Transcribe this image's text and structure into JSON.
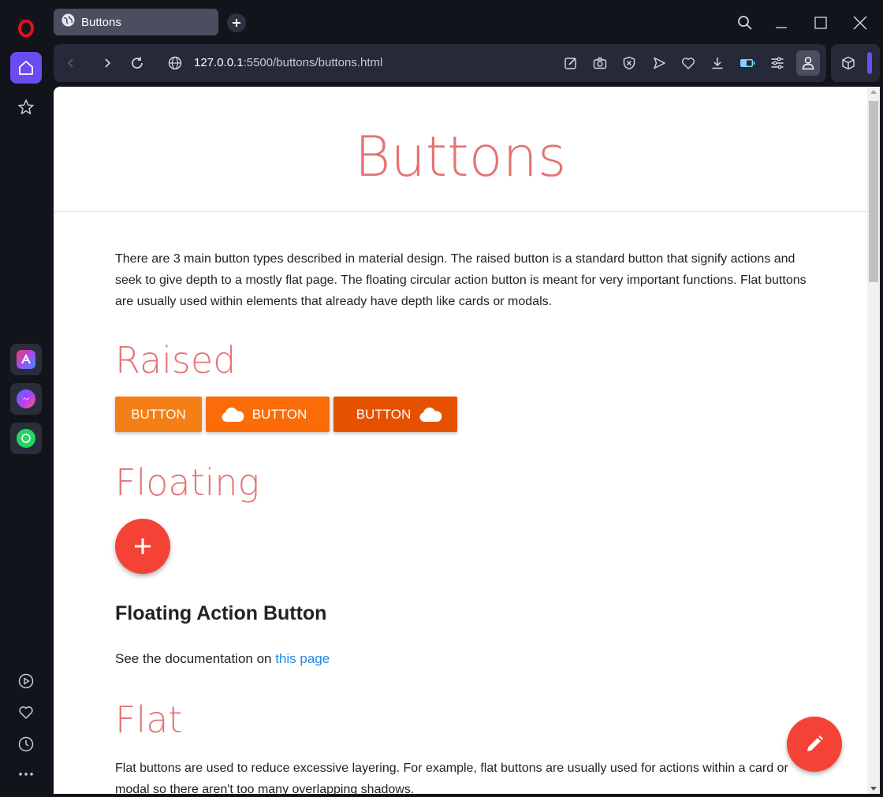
{
  "browser": {
    "tab": {
      "title": "Buttons"
    },
    "address": {
      "host": "127.0.0.1",
      "rest": ":5500/buttons/buttons.html"
    }
  },
  "page": {
    "title": "Buttons",
    "intro": "There are 3 main button types described in material design. The raised button is a standard button that signify actions and seek to give depth to a mostly flat page. The floating circular action button is meant for very important functions. Flat buttons are usually used within elements that already have depth like cards or modals.",
    "sections": {
      "raised": {
        "heading": "Raised",
        "buttons": [
          "BUTTON",
          "BUTTON",
          "BUTTON"
        ]
      },
      "floating": {
        "heading": "Floating",
        "subheading": "Floating Action Button",
        "doc_prefix": "See the documentation on",
        "doc_link": "this page"
      },
      "flat": {
        "heading": "Flat",
        "text": "Flat buttons are used to reduce excessive layering. For example, flat buttons are usually used for actions within a card or modal so there aren't too many overlapping shadows."
      }
    }
  },
  "colors": {
    "accent_heading": "#e57373",
    "raised_1": "#f57f17",
    "raised_2": "#fb6c08",
    "raised_3": "#e65100",
    "fab": "#f44336",
    "link": "#1e88e5",
    "sidebar_active": "#6a4cf0"
  },
  "icons": {
    "sidebar": [
      "opera-logo-icon",
      "home-icon",
      "star-icon",
      "aria-icon",
      "messenger-icon",
      "whatsapp-icon",
      "player-icon",
      "heart-icon",
      "history-icon",
      "more-icon"
    ],
    "toolbar": [
      "snapshot-edit-icon",
      "camera-icon",
      "adblock-icon",
      "send-icon",
      "heart-icon",
      "download-icon",
      "battery-icon",
      "easy-setup-icon",
      "profile-icon",
      "extensions-icon"
    ]
  }
}
